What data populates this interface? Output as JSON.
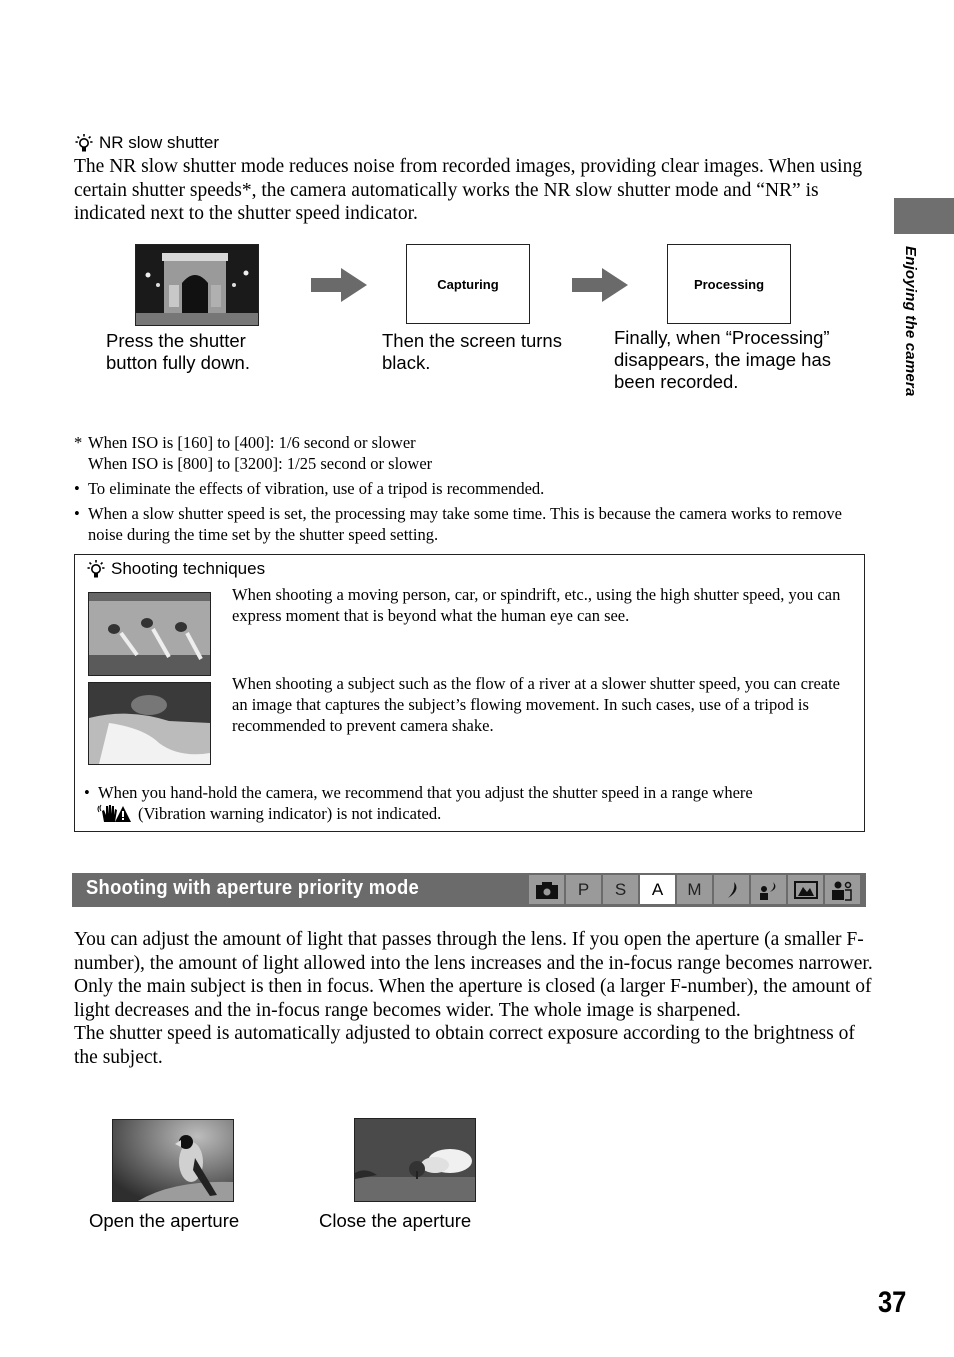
{
  "side_tab": {
    "label": "Enjoying the camera"
  },
  "nr_section": {
    "title": "NR slow shutter",
    "icon": "hint-bulb-icon",
    "body": "The NR slow shutter mode reduces noise from recorded images, providing clear images. When using certain shutter speeds*, the camera automatically works the NR slow shutter mode and “NR” is indicated next to the shutter speed indicator.",
    "flow": [
      {
        "image": "arc-de-triomphe-night-photo",
        "caption": "Press the shutter button fully down."
      },
      {
        "screen_text": "Capturing",
        "caption": "Then the screen turns black."
      },
      {
        "screen_text": "Processing",
        "caption": "Finally, when “Processing” disappears, the image has been recorded."
      }
    ],
    "footnote": {
      "mark": "*",
      "lines": [
        "When ISO is [160] to [400]: 1/6 second or slower",
        "When ISO is [800] to [3200]: 1/25 second or slower"
      ]
    },
    "bullets": [
      "To eliminate the effects of vibration, use of a tripod is recommended.",
      "When a slow shutter speed is set, the processing may take some time. This is because the camera works to remove noise during the time set by the shutter speed setting."
    ]
  },
  "techniques": {
    "title": "Shooting techniques",
    "items": [
      {
        "image": "sprinters-photo",
        "text": "When shooting a moving person, car, or spindrift, etc., using the high shutter speed, you can express moment that is beyond what the human eye can see."
      },
      {
        "image": "river-waterfall-photo",
        "text": "When shooting a subject such as the flow of a river at a slower shutter speed, you can create an image that captures the subject’s flowing movement. In such cases, use of a tripod is recommended to prevent camera shake."
      }
    ],
    "bullet_before": "When you hand-hold the camera, we recommend that you adjust the shutter speed in a range where",
    "bullet_after": "(Vibration warning indicator) is not indicated.",
    "bullet_icon": "vibration-warning-icon"
  },
  "aperture_section": {
    "title": "Shooting with aperture priority mode",
    "modes": [
      {
        "label": "",
        "icon": "camera-auto-icon",
        "active": false
      },
      {
        "label": "P",
        "active": false
      },
      {
        "label": "S",
        "active": false
      },
      {
        "label": "A",
        "active": true
      },
      {
        "label": "M",
        "active": false
      },
      {
        "label": "",
        "icon": "twilight-moon-icon",
        "active": false
      },
      {
        "label": "",
        "icon": "twilight-portrait-icon",
        "active": false
      },
      {
        "label": "",
        "icon": "landscape-icon",
        "active": false
      },
      {
        "label": "",
        "icon": "soft-snap-icon",
        "active": false
      }
    ],
    "body_1": "You can adjust the amount of light that passes through the lens. If you open the aperture (a smaller F-number), the amount of light allowed into the lens increases and the in-focus range becomes narrower. Only the main subject is then in focus. When the aperture is closed (a larger F-number), the amount of light decreases and the in-focus range becomes wider. The whole image is sharpened.",
    "body_2": "The shutter speed is automatically adjusted to obtain correct exposure according to the brightness of the subject.",
    "examples": [
      {
        "image": "bird-photo",
        "caption": "Open the aperture"
      },
      {
        "image": "tree-field-photo",
        "caption": "Close the aperture"
      }
    ]
  },
  "page_number": "37"
}
